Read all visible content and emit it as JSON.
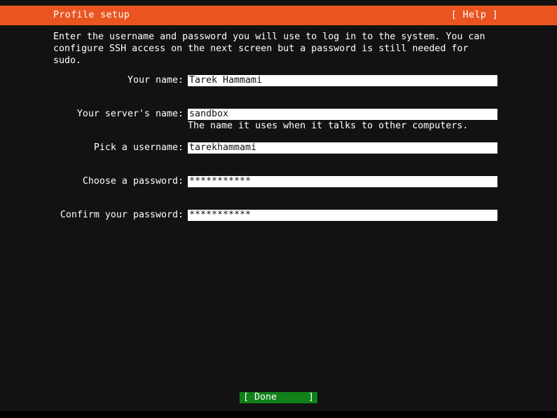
{
  "header": {
    "title": "Profile setup",
    "help_label": "[ Help ]",
    "bg_color": "#e95420",
    "fg_color": "#ffffff"
  },
  "intro": {
    "text": "Enter the username and password you will use to log in to the system. You can\nconfigure SSH access on the next screen but a password is still needed for\nsudo."
  },
  "form": {
    "fields": [
      {
        "label": "Your name:",
        "value": "Tarek Hammami",
        "help": ""
      },
      {
        "label": "Your server's name:",
        "value": "sandbox",
        "help": "The name it uses when it talks to other computers."
      },
      {
        "label": "Pick a username:",
        "value": "tarekhammami",
        "help": ""
      },
      {
        "label": "Choose a password:",
        "value": "***********",
        "help": ""
      },
      {
        "label": "Confirm your password:",
        "value": "***********",
        "help": ""
      }
    ]
  },
  "footer": {
    "done_left": "[ Done",
    "done_right": "]",
    "bg_color": "#108018"
  },
  "theme": {
    "background": "#121212",
    "foreground": "#ffffff",
    "input_bg": "#ffffff",
    "input_fg": "#111111"
  }
}
